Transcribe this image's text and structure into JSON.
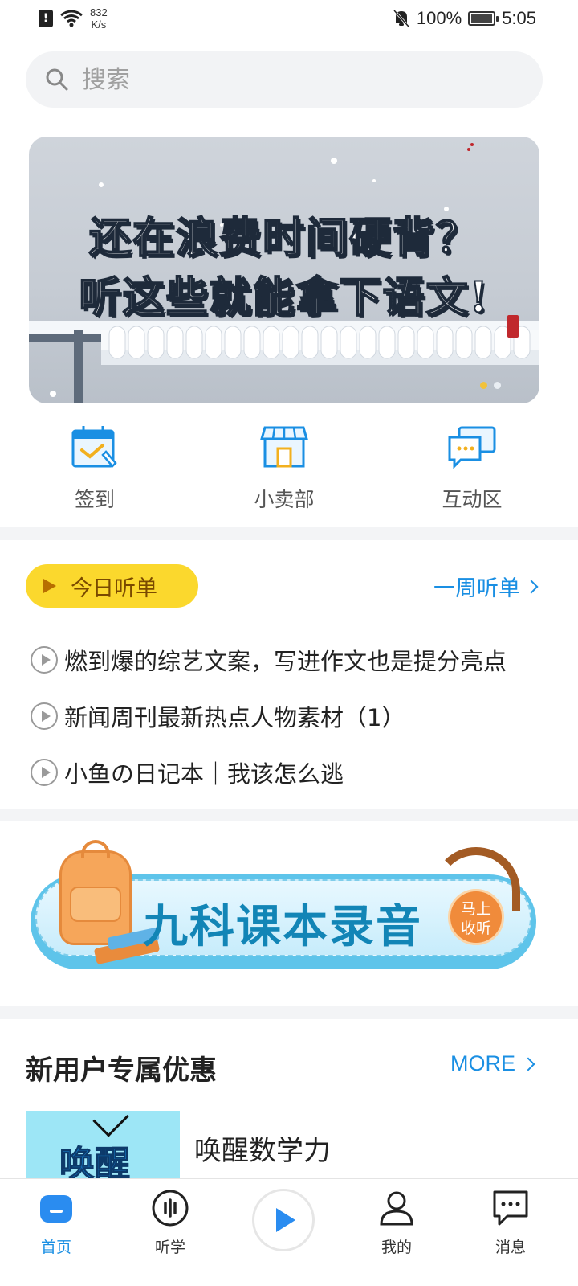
{
  "status_bar": {
    "speed_value": "832",
    "speed_unit": "K/s",
    "battery": "100%",
    "time": "5:05"
  },
  "search": {
    "placeholder": "搜索"
  },
  "banner": {
    "line1": "还在浪费时间硬背？",
    "line2": "听这些就能拿下语文!",
    "slide_count": 2,
    "active_slide": 1
  },
  "quick_actions": [
    {
      "label": "签到",
      "icon": "calendar-check-icon"
    },
    {
      "label": "小卖部",
      "icon": "shop-icon"
    },
    {
      "label": "互动区",
      "icon": "chat-bubbles-icon"
    }
  ],
  "today": {
    "button_label": "今日听单",
    "week_link": "一周听单",
    "items": [
      "燃到爆的综艺文案，写进作文也是提分亮点",
      "新闻周刊最新热点人物素材（1）",
      "小鱼の日记本｜我该怎么逃"
    ]
  },
  "promo": {
    "title": "九科课本录音",
    "badge_line1": "马上",
    "badge_line2": "收听"
  },
  "new_user": {
    "title": "新用户专属优惠",
    "more": "MORE",
    "course_thumb_text": "唤醒",
    "course_name": "唤醒数学力"
  },
  "tabbar": {
    "tabs": [
      {
        "label": "首页",
        "icon": "home-icon",
        "active": true
      },
      {
        "label": "听学",
        "icon": "sound-wave-icon",
        "active": false
      },
      {
        "label": "我的",
        "icon": "user-icon",
        "active": false
      },
      {
        "label": "消息",
        "icon": "message-icon",
        "active": false
      }
    ]
  },
  "colors": {
    "accent": "#1a8fe3",
    "today_button": "#fbd82d",
    "promo_blue": "#5ec4ea"
  }
}
